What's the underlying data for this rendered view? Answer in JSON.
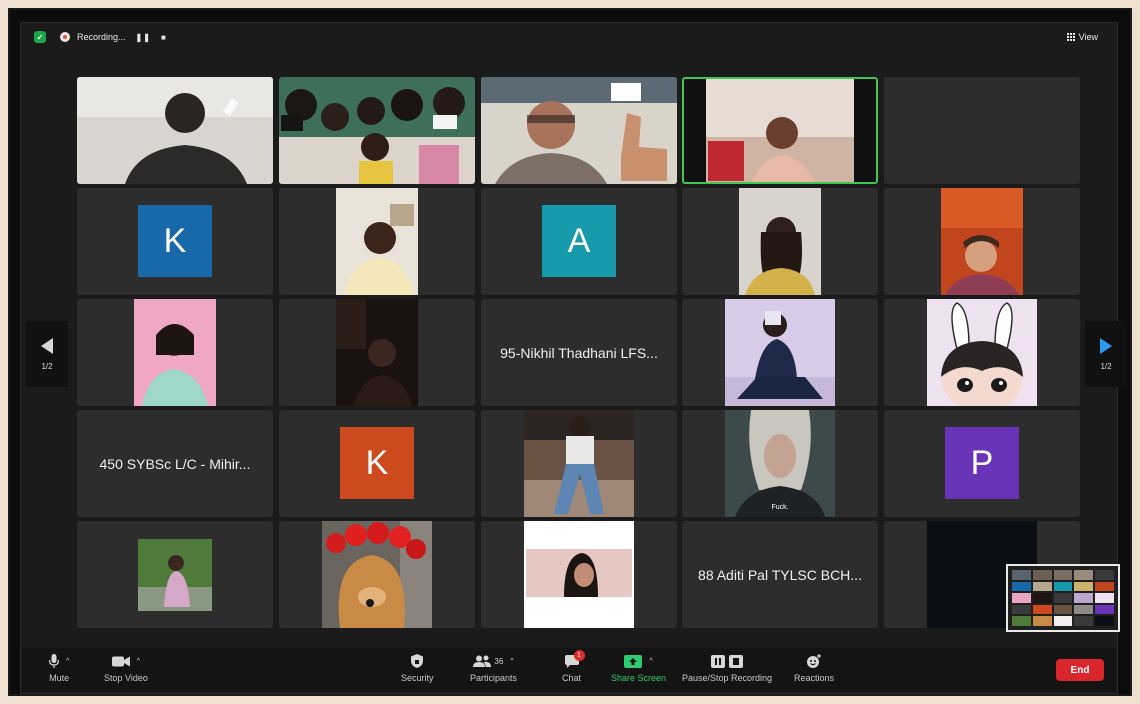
{
  "topbar": {
    "recording_label": "Recording...",
    "pause_glyph": "❚❚",
    "stop_glyph": "■",
    "view_label": "View"
  },
  "tiles": {
    "r3c3_name": "95-Nikhil Thadhani LFS...",
    "r4c1_name": "450 SYBSc L/C - Mihir...",
    "r5c4_name": "88 Aditi Pal TYLSC BCH...",
    "r2c1_letter": "K",
    "r2c3_letter": "A",
    "r4c2_letter": "K",
    "r4c5_letter": "P",
    "r4c4_caption": "Fuck."
  },
  "pager": {
    "left_label": "1/2",
    "right_label": "1/2"
  },
  "toolbar": {
    "mute": "Mute",
    "stop_video": "Stop Video",
    "security": "Security",
    "participants": "Participants",
    "participants_count": "36",
    "chat": "Chat",
    "chat_badge": "1",
    "share_screen": "Share Screen",
    "pause_stop_recording": "Pause/Stop Recording",
    "reactions": "Reactions",
    "end": "End"
  },
  "colors": {
    "avatar_blue": "#1769aa",
    "avatar_teal": "#179aab",
    "avatar_orange": "#cc4a1d",
    "avatar_purple": "#6a34b8",
    "active_speaker": "#41c650",
    "end_red": "#d9262c",
    "share_green": "#2ecc71"
  },
  "icons": [
    "shield-icon",
    "record-icon",
    "grid-icon",
    "microphone-icon",
    "camera-icon",
    "lock-shield-icon",
    "participants-icon",
    "chat-icon",
    "share-screen-icon",
    "pause-stop-icon",
    "reaction-icon",
    "arrow-left-icon",
    "arrow-right-icon"
  ]
}
